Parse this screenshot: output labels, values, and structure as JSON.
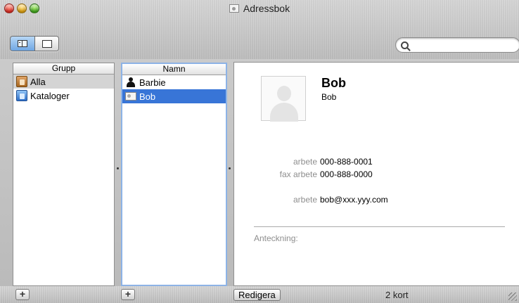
{
  "window": {
    "title": "Adressbok"
  },
  "toolbar": {
    "view_buttons": [
      {
        "name": "list-view",
        "active": true
      },
      {
        "name": "card-view",
        "active": false
      }
    ],
    "search": {
      "value": "",
      "placeholder": ""
    }
  },
  "group_column": {
    "header": "Grupp",
    "items": [
      {
        "label": "Alla",
        "icon": "address-book-icon",
        "selected": true
      },
      {
        "label": "Kataloger",
        "icon": "directory-icon",
        "selected": false
      }
    ]
  },
  "name_column": {
    "header": "Namn",
    "items": [
      {
        "label": "Barbie",
        "icon": "person-icon",
        "selected": false
      },
      {
        "label": "Bob",
        "icon": "card-icon",
        "selected": true
      }
    ]
  },
  "detail": {
    "name": "Bob",
    "company": "Bob",
    "fields": [
      {
        "label": "arbete",
        "value": "000-888-0001"
      },
      {
        "label": "fax arbete",
        "value": "000-888-0000"
      },
      {
        "label": "arbete",
        "value": "bob@xxx.yyy.com"
      }
    ],
    "note_label": "Anteckning:"
  },
  "bottom": {
    "add_group": "+",
    "add_person": "+",
    "edit_button": "Redigera",
    "count": "2 kort"
  },
  "colors": {
    "selection_blue": "#3875d7",
    "selection_gray": "#d4d4d4",
    "focus_ring": "#8db3e6"
  }
}
